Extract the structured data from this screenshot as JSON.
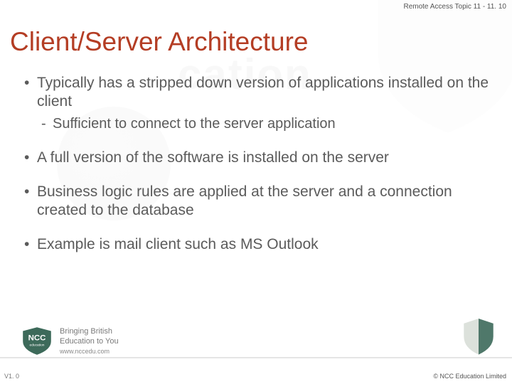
{
  "header": {
    "topic": "Remote Access  Topic 11 - 11. 10"
  },
  "title": "Client/Server Architecture",
  "bullets": [
    {
      "text": "Typically has a stripped down version of applications installed on the client",
      "sub": [
        "Sufficient to connect to the server application"
      ]
    },
    {
      "text": "A full version of the software is installed on the server",
      "sub": []
    },
    {
      "text": "Business logic rules are applied at the server and a connection created to the database",
      "sub": []
    },
    {
      "text": "Example is mail client such as MS Outlook",
      "sub": []
    }
  ],
  "footer": {
    "tagline1": "Bringing British",
    "tagline2": "Education to You",
    "url": "www.nccedu.com",
    "logo_label": "NCC",
    "logo_sub": "education"
  },
  "version": "V1. 0",
  "copyright": "©  NCC Education Limited"
}
